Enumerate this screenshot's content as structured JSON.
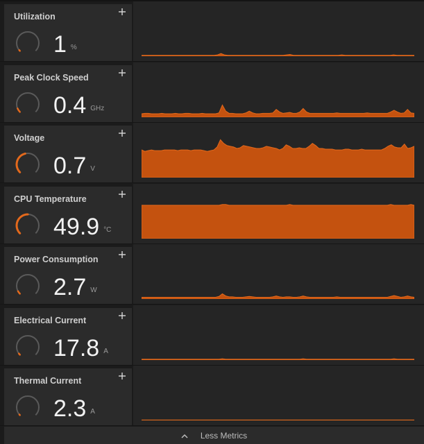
{
  "colors": {
    "accent": "#e3691c",
    "area_fill": "#c4520f",
    "gauge_track": "#5a5a5a"
  },
  "metrics": [
    {
      "label": "Utilization",
      "value": "1",
      "unit": "%",
      "gauge_fraction": 0.02,
      "series": [
        2,
        2,
        2,
        2,
        2,
        2,
        2,
        2,
        2,
        2,
        2,
        2,
        2,
        2,
        2,
        2,
        2,
        2,
        2,
        2,
        2,
        2,
        3,
        6,
        3,
        2,
        2,
        2,
        2,
        2,
        2,
        2,
        2,
        2,
        2,
        2,
        2,
        2,
        2,
        2,
        2,
        2,
        3,
        4,
        2,
        2,
        2,
        2,
        2,
        2,
        2,
        2,
        2,
        2,
        2,
        2,
        2,
        2,
        3,
        2,
        2,
        2,
        2,
        2,
        2,
        2,
        2,
        2,
        2,
        2,
        2,
        2,
        2,
        3,
        2,
        2,
        2,
        2,
        2,
        2
      ],
      "max": 100
    },
    {
      "label": "Peak Clock Speed",
      "value": "0.4",
      "unit": "GHz",
      "gauge_fraction": 0.08,
      "series": [
        8,
        9,
        9,
        8,
        8,
        8,
        9,
        8,
        8,
        8,
        9,
        8,
        8,
        9,
        9,
        8,
        8,
        8,
        9,
        8,
        8,
        8,
        8,
        10,
        28,
        14,
        9,
        9,
        8,
        8,
        8,
        10,
        14,
        10,
        8,
        8,
        9,
        9,
        9,
        10,
        18,
        12,
        9,
        10,
        11,
        9,
        9,
        12,
        20,
        12,
        9,
        9,
        9,
        9,
        9,
        9,
        9,
        9,
        10,
        9,
        9,
        9,
        9,
        9,
        9,
        9,
        9,
        10,
        9,
        9,
        9,
        9,
        9,
        9,
        12,
        16,
        12,
        9,
        10,
        18,
        10,
        9
      ],
      "max": 100
    },
    {
      "label": "Voltage",
      "value": "0.7",
      "unit": "V",
      "gauge_fraction": 0.45,
      "series": [
        38,
        36,
        37,
        38,
        37,
        37,
        37,
        38,
        38,
        38,
        38,
        37,
        38,
        38,
        38,
        37,
        38,
        38,
        38,
        37,
        36,
        37,
        38,
        42,
        52,
        47,
        44,
        43,
        42,
        40,
        41,
        44,
        43,
        42,
        41,
        40,
        40,
        41,
        43,
        42,
        41,
        40,
        38,
        40,
        45,
        43,
        40,
        40,
        41,
        40,
        40,
        43,
        47,
        44,
        40,
        40,
        39,
        39,
        39,
        38,
        38,
        38,
        39,
        39,
        38,
        38,
        38,
        39,
        38,
        38,
        38,
        38,
        38,
        38,
        40,
        43,
        45,
        42,
        41,
        41,
        46,
        40,
        41,
        43
      ],
      "max": 60
    },
    {
      "label": "CPU Temperature",
      "value": "49.9",
      "unit": "°C",
      "gauge_fraction": 0.5,
      "series": [
        42,
        42,
        42,
        42,
        42,
        42,
        42,
        42,
        42,
        42,
        42,
        42,
        42,
        42,
        42,
        42,
        42,
        42,
        42,
        42,
        42,
        42,
        42,
        42,
        43,
        43,
        42,
        42,
        42,
        42,
        42,
        42,
        42,
        42,
        42,
        42,
        42,
        42,
        42,
        42,
        42,
        42,
        42,
        42,
        43,
        42,
        42,
        42,
        42,
        42,
        42,
        42,
        42,
        42,
        42,
        42,
        42,
        42,
        42,
        42,
        42,
        42,
        42,
        42,
        42,
        42,
        42,
        42,
        42,
        42,
        42,
        42,
        42,
        42,
        43,
        42,
        42,
        42,
        42,
        42,
        43,
        42
      ],
      "max": 55
    },
    {
      "label": "Power Consumption",
      "value": "2.7",
      "unit": "W",
      "gauge_fraction": 0.06,
      "series": [
        4,
        4,
        4,
        4,
        4,
        4,
        4,
        4,
        4,
        4,
        4,
        4,
        4,
        4,
        4,
        4,
        4,
        4,
        4,
        4,
        4,
        4,
        4,
        6,
        12,
        7,
        5,
        5,
        4,
        4,
        4,
        5,
        6,
        5,
        4,
        4,
        4,
        4,
        4,
        5,
        7,
        5,
        4,
        5,
        5,
        4,
        4,
        5,
        7,
        5,
        4,
        4,
        4,
        4,
        4,
        4,
        4,
        4,
        5,
        4,
        4,
        4,
        4,
        4,
        4,
        4,
        4,
        4,
        4,
        4,
        4,
        4,
        4,
        4,
        6,
        8,
        6,
        4,
        5,
        7,
        5,
        4
      ],
      "max": 100
    },
    {
      "label": "Electrical Current",
      "value": "17.8",
      "unit": "A",
      "gauge_fraction": 0.03,
      "series": [
        2,
        2,
        2,
        2,
        2,
        2,
        2,
        2,
        2,
        2,
        2,
        2,
        2,
        2,
        2,
        2,
        2,
        2,
        2,
        2,
        2,
        2,
        2,
        2,
        3,
        2,
        2,
        2,
        2,
        2,
        2,
        2,
        2,
        2,
        2,
        2,
        2,
        2,
        2,
        2,
        2,
        2,
        2,
        2,
        2,
        2,
        2,
        2,
        3,
        2,
        2,
        2,
        2,
        2,
        2,
        2,
        2,
        2,
        2,
        2,
        2,
        2,
        2,
        2,
        2,
        2,
        2,
        2,
        2,
        2,
        2,
        2,
        2,
        2,
        2,
        3,
        2,
        2,
        2,
        2,
        2,
        2
      ],
      "max": 100
    },
    {
      "label": "Thermal Current",
      "value": "2.3",
      "unit": "A",
      "gauge_fraction": 0.0,
      "series": [
        1,
        1,
        1,
        1,
        1,
        1,
        1,
        1,
        1,
        1,
        1,
        1,
        1,
        1,
        1,
        1,
        1,
        1,
        1,
        1,
        1,
        1,
        1,
        1,
        1,
        1,
        1,
        1,
        1,
        1,
        1,
        1,
        1,
        1,
        1,
        1,
        1,
        1,
        1,
        1,
        1,
        1,
        1,
        1,
        1,
        1,
        1,
        1,
        1,
        1,
        1,
        1,
        1,
        1,
        1,
        1,
        1,
        1,
        1,
        1,
        1,
        1,
        1,
        1,
        1,
        1,
        1,
        1,
        1,
        1,
        1,
        1,
        1,
        1,
        1,
        1,
        1,
        1,
        1,
        1,
        1,
        1
      ],
      "max": 100
    }
  ],
  "footer": {
    "label": "Less Metrics"
  }
}
